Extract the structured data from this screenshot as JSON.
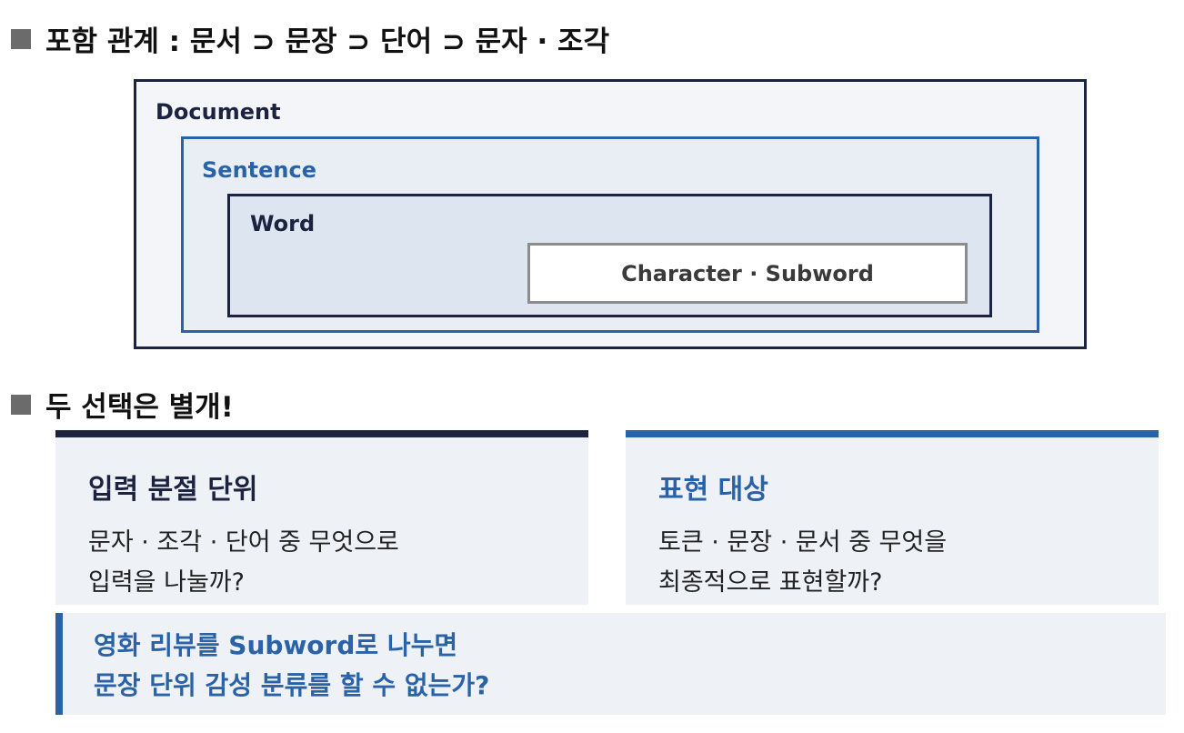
{
  "heading_hierarchy": "포함 관계 : 문서 ⊃ 문장 ⊃ 단어 ⊃ 문자 · 조각",
  "heading_choices": "두 선택은 별개!",
  "boxes": {
    "document": "Document",
    "sentence": "Sentence",
    "word": "Word",
    "character": "Character · Subword"
  },
  "cards": {
    "input": {
      "title": "입력 분절 단위",
      "line1": "문자 · 조각 · 단어 중 무엇으로",
      "line2": "입력을 나눌까?"
    },
    "representation": {
      "title": "표현 대상",
      "line1": "토큰 · 문장 · 문서 중 무엇을",
      "line2": "최종적으로 표현할까?"
    }
  },
  "question": {
    "line1": "영화 리뷰를 Subword로 나누면",
    "line2": "문장 단위 감성 분류를 할 수 없는가?"
  },
  "colors": {
    "navy": "#1c2340",
    "blue": "#2a62a8",
    "gray": "#8c8c8c"
  }
}
